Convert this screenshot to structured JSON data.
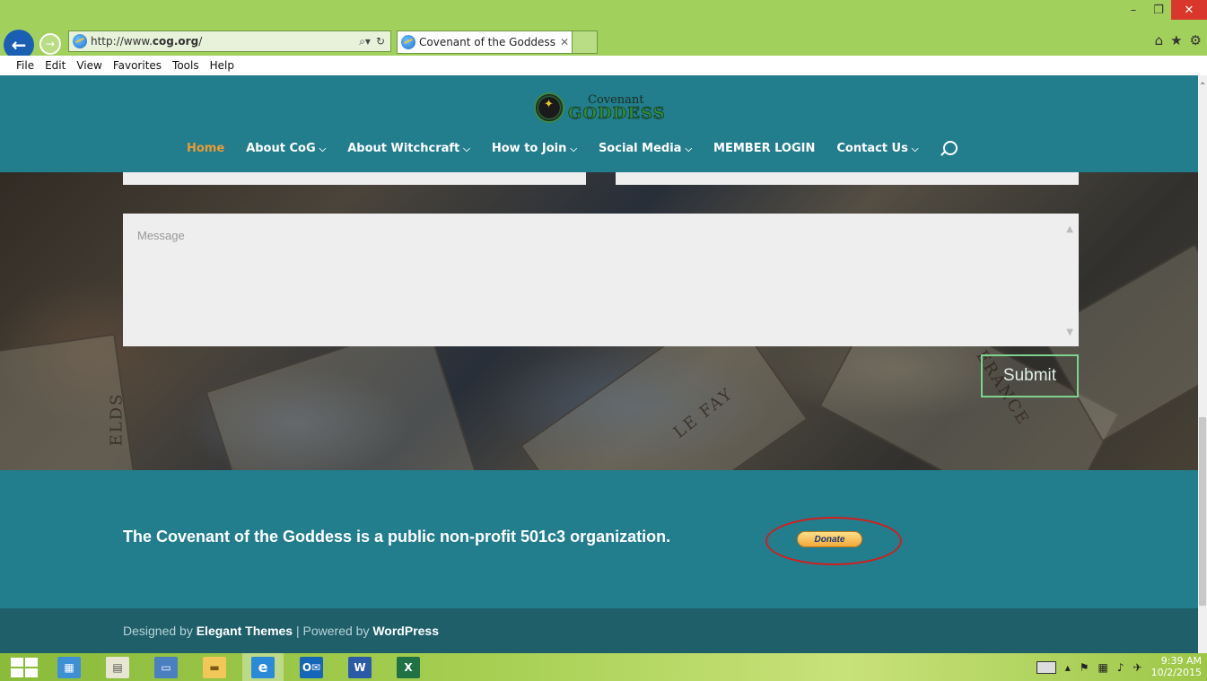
{
  "browser": {
    "url_prefix": "http://www.",
    "url_domain": "cog.org",
    "url_suffix": "/",
    "tab_title": "Covenant of the Goddess | ...",
    "menu": [
      "File",
      "Edit",
      "View",
      "Favorites",
      "Tools",
      "Help"
    ]
  },
  "site": {
    "logo_top": "Covenant",
    "logo_bottom": "GODDESS",
    "nav": [
      {
        "label": "Home",
        "active": true,
        "dropdown": false
      },
      {
        "label": "About CoG",
        "active": false,
        "dropdown": true
      },
      {
        "label": "About Witchcraft",
        "active": false,
        "dropdown": true
      },
      {
        "label": "How to Join",
        "active": false,
        "dropdown": true
      },
      {
        "label": "Social Media",
        "active": false,
        "dropdown": true
      },
      {
        "label": "MEMBER LOGIN",
        "active": false,
        "dropdown": false
      },
      {
        "label": "Contact Us",
        "active": false,
        "dropdown": true
      }
    ]
  },
  "contact": {
    "message_placeholder": "Message",
    "submit_label": "Submit"
  },
  "hero_card_text": {
    "left": "ELDS",
    "middle": "LE FAY",
    "right": "ERANCE"
  },
  "footer": {
    "nonprofit_text": "The Covenant of the Goddess is a public non-profit 501c3 organization.",
    "donate_label": "Donate",
    "credits_designed": "Designed by ",
    "credits_elegant": "Elegant Themes",
    "credits_sep": " | Powered by ",
    "credits_wp": "WordPress"
  },
  "taskbar": {
    "time": "9:39 AM",
    "date": "10/2/2015"
  },
  "colors": {
    "teal": "#227d8d",
    "footer_dark": "#1e5f6a",
    "nav_active": "#e89c35",
    "submit_border": "#7fd18e",
    "highlight_circle": "#d21e1e"
  }
}
